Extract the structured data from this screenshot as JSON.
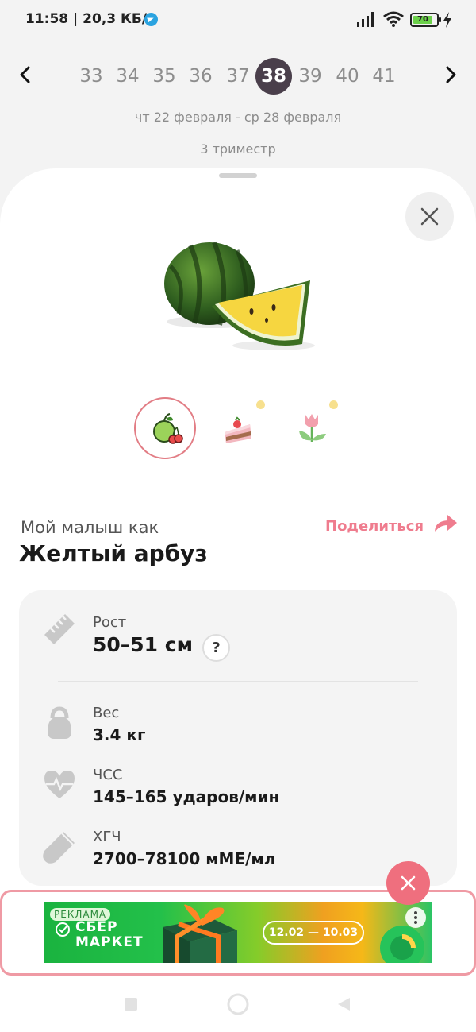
{
  "status_bar": {
    "time": "11:58",
    "speed": "20,3 КБ/с",
    "battery": "70",
    "icons": [
      "telegram-icon",
      "signal-icon",
      "wifi-icon",
      "battery-icon",
      "charging-icon"
    ]
  },
  "week_nav": {
    "weeks": [
      "33",
      "34",
      "35",
      "36",
      "37",
      "38",
      "39",
      "40",
      "41"
    ],
    "selected_week": "38",
    "date_range": "чт 22 февраля - ср 28 февраля",
    "trimester": "3 триместр"
  },
  "comparison": {
    "intro": "Мой малыш как",
    "fruit": "Желтый арбуз",
    "share_label": "Поделиться",
    "tabs": [
      "fruit-tab",
      "dessert-tab",
      "flower-tab"
    ]
  },
  "stats": {
    "height": {
      "label": "Рост",
      "value": "50–51 см",
      "help": "?"
    },
    "weight": {
      "label": "Вес",
      "value": "3.4 кг"
    },
    "heart_rate": {
      "label": "ЧСС",
      "value": "145–165 ударов/мин"
    },
    "hcg": {
      "label": "ХГЧ",
      "value": "2700–78100 мМЕ/мл"
    }
  },
  "ad": {
    "badge": "РЕКЛАМА",
    "brand_line1": "СБЕР",
    "brand_line2": "МАРКЕТ",
    "dates": "12.02 — 10.03"
  },
  "colors": {
    "accent": "#ef7c8e",
    "active_week": "#4a3f4b",
    "card_bg": "#f4f4f4"
  }
}
